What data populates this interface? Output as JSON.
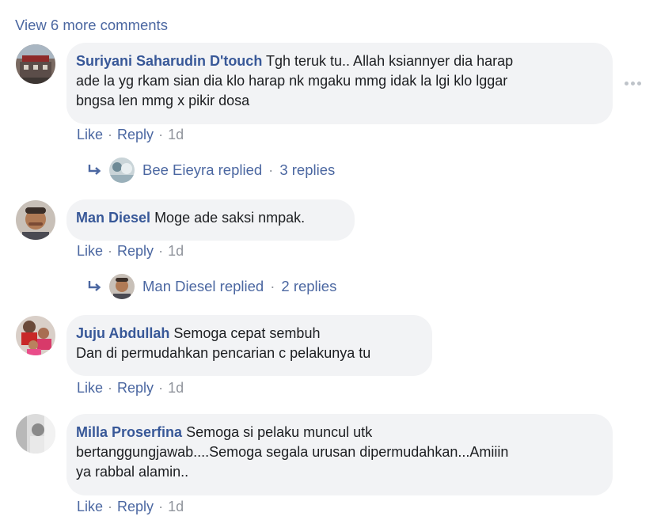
{
  "view_more": "View 6 more comments",
  "comments": [
    {
      "author": "Suriyani Saharudin D'touch",
      "text_lines": [
        "Tgh teruk tu.. Allah ksiannyer dia harap",
        "ade la yg rkam sian dia klo harap nk mgaku mmg idak la lgi klo lggar",
        "bngsa len mmg x pikir dosa"
      ],
      "like": "Like",
      "reply": "Reply",
      "time": "1d",
      "replies": {
        "name": "Bee Eieyra replied",
        "count": "3 replies"
      }
    },
    {
      "author": "Man Diesel",
      "text_lines": [
        "Moge ade saksi nmpak."
      ],
      "like": "Like",
      "reply": "Reply",
      "time": "1d",
      "replies": {
        "name": "Man Diesel replied",
        "count": "2 replies"
      }
    },
    {
      "author": "Juju Abdullah",
      "text_lines": [
        "Semoga cepat sembuh",
        "Dan di permudahkan pencarian c pelakunya tu"
      ],
      "like": "Like",
      "reply": "Reply",
      "time": "1d"
    },
    {
      "author": "Milla Proserfina",
      "text_lines": [
        "Semoga si pelaku muncul utk",
        "bertanggungjawab....Semoga segala urusan dipermudahkan...Amiiin",
        "ya rabbal alamin.."
      ],
      "like": "Like",
      "reply": "Reply",
      "time": "1d"
    }
  ],
  "sep": "·",
  "icons": {
    "more": "more-options-icon",
    "reply_arrow": "reply-arrow-icon"
  }
}
